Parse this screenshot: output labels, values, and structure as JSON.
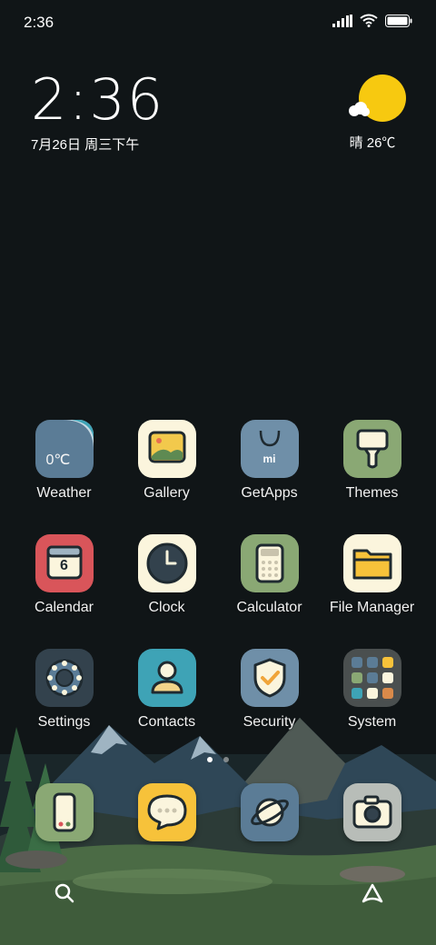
{
  "status_bar": {
    "time": "2:36"
  },
  "clock_widget": {
    "time": "2:36",
    "date": "7月26日 周三下午"
  },
  "weather_widget": {
    "summary": "晴 26℃"
  },
  "apps": [
    {
      "label": "Weather",
      "icon": "weather-icon",
      "tile_text": "0℃"
    },
    {
      "label": "Gallery",
      "icon": "gallery-icon"
    },
    {
      "label": "GetApps",
      "icon": "getapps-icon",
      "tile_text": "mi"
    },
    {
      "label": "Themes",
      "icon": "themes-brush-icon"
    },
    {
      "label": "Calendar",
      "icon": "calendar-icon",
      "tile_text": "6"
    },
    {
      "label": "Clock",
      "icon": "clock-face-icon"
    },
    {
      "label": "Calculator",
      "icon": "calculator-icon"
    },
    {
      "label": "File Manager",
      "icon": "folder-icon"
    },
    {
      "label": "Settings",
      "icon": "gear-icon"
    },
    {
      "label": "Contacts",
      "icon": "person-icon"
    },
    {
      "label": "Security",
      "icon": "shield-check-icon"
    },
    {
      "label": "System",
      "icon": "folder-grid-icon"
    }
  ],
  "dock": [
    {
      "icon": "phone-icon"
    },
    {
      "icon": "messages-icon"
    },
    {
      "icon": "browser-planet-icon"
    },
    {
      "icon": "camera-icon"
    }
  ],
  "bottom_bar": {
    "left_icon": "search-icon",
    "right_icon": "assistant-icon"
  },
  "colors": {
    "background": "#101517",
    "sun": "#f7c910",
    "cream": "#fbf5dd",
    "slate": "#5b7c96",
    "sage": "#8aa874",
    "red": "#d9555a",
    "teal": "#3ea3b6",
    "yellow": "#f7c23a"
  }
}
